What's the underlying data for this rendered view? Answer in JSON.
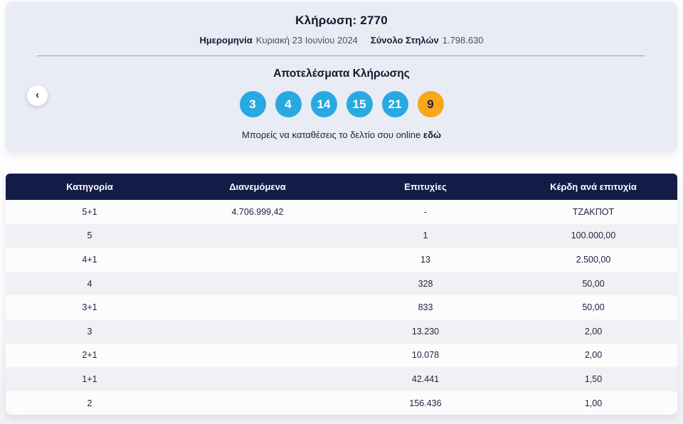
{
  "draw_panel": {
    "title": "Κλήρωση: 2770",
    "date_label": "Ημερομηνία",
    "date_value": "Κυριακή 23 Ιουνίου 2024",
    "columns_label": "Σύνολο Στηλών",
    "columns_value": "1.798.630",
    "results_title": "Αποτελέσματα Κλήρωσης",
    "prev_button_icon": "‹",
    "numbers": [
      {
        "value": "3",
        "type": "main"
      },
      {
        "value": "4",
        "type": "main"
      },
      {
        "value": "14",
        "type": "main"
      },
      {
        "value": "15",
        "type": "main"
      },
      {
        "value": "21",
        "type": "main"
      },
      {
        "value": "9",
        "type": "bonus"
      }
    ],
    "caption_text": "Μπορείς να καταθέσεις το δελτίο σου online",
    "caption_link": "εδώ"
  },
  "table": {
    "headers": [
      "Κατηγορία",
      "Διανεμόμενα",
      "Επιτυχίες",
      "Κέρδη ανά επιτυχία"
    ],
    "rows": [
      [
        "5+1",
        "4.706.999,42",
        "-",
        "ΤΖΑΚΠΟΤ"
      ],
      [
        "5",
        "",
        "1",
        "100.000,00"
      ],
      [
        "4+1",
        "",
        "13",
        "2.500,00"
      ],
      [
        "4",
        "",
        "328",
        "50,00"
      ],
      [
        "3+1",
        "",
        "833",
        "50,00"
      ],
      [
        "3",
        "",
        "13.230",
        "2,00"
      ],
      [
        "2+1",
        "",
        "10.078",
        "2,00"
      ],
      [
        "1+1",
        "",
        "42.441",
        "1,50"
      ],
      [
        "2",
        "",
        "156.436",
        "1,00"
      ]
    ]
  },
  "colors": {
    "main_number_bg": "#29a9e1",
    "bonus_number_bg": "#f9a61b",
    "table_header_bg": "#131b47",
    "panel_bg": "#e9ecf4"
  }
}
